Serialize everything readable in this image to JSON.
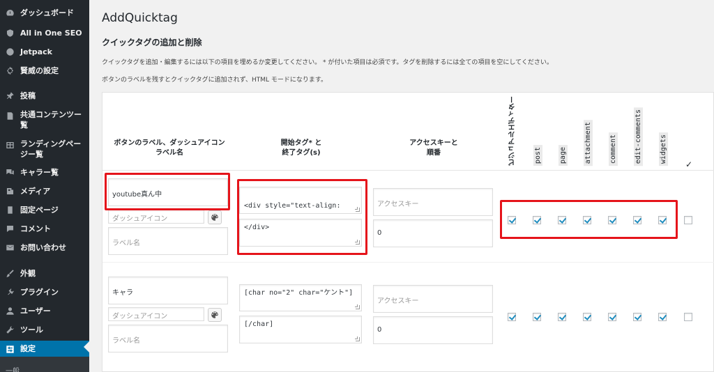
{
  "sidebar": {
    "items": [
      {
        "label": "ダッシュボード",
        "icon": "dashboard-icon"
      },
      {
        "label": "All in One SEO",
        "icon": "shield-icon"
      },
      {
        "label": "Jetpack",
        "icon": "jetpack-icon"
      },
      {
        "label": "賢威の設定",
        "icon": "gear-icon"
      },
      {
        "label": "投稿",
        "icon": "pin-icon"
      },
      {
        "label": "共通コンテンツー覧",
        "icon": "document-icon"
      },
      {
        "label": "ランディングページー覧",
        "icon": "table-icon"
      },
      {
        "label": "キャラー覧",
        "icon": "comments-icon"
      },
      {
        "label": "メディア",
        "icon": "media-icon"
      },
      {
        "label": "固定ページ",
        "icon": "page-icon"
      },
      {
        "label": "コメント",
        "icon": "comment-icon"
      },
      {
        "label": "お問い合わせ",
        "icon": "mail-icon"
      },
      {
        "label": "外観",
        "icon": "brush-icon"
      },
      {
        "label": "プラグイン",
        "icon": "plugin-icon"
      },
      {
        "label": "ユーザー",
        "icon": "user-icon"
      },
      {
        "label": "ツール",
        "icon": "wrench-icon"
      },
      {
        "label": "設定",
        "icon": "settings-icon"
      }
    ],
    "submenu_first": "一般"
  },
  "page": {
    "title": "AddQuicktag",
    "section_title": "クイックタグの追加と削除",
    "desc1": "クイックタグを追加・編集するには以下の項目を埋めるか変更してください。 * が付いた項目は必須です。タグを削除するには全ての項目を空にしてください。",
    "desc2": "ボタンのラベルを残すとクイックタグに追加されず、HTML モードになります。"
  },
  "table": {
    "headers": {
      "label": "ボタンのラベル、ダッシュアイコン\nラベル名",
      "tags": "開始タグ* と\n終了タグ(s)",
      "access": "アクセスキーと\n順番"
    },
    "columns": [
      "ビジュアルエディター",
      "post",
      "page",
      "attachment",
      "comment",
      "edit-comments",
      "widgets"
    ],
    "check_all": "✓",
    "rows": [
      {
        "button_label": "youtube真ん中",
        "dashicon_placeholder": "ダッシュアイコン",
        "label_name_placeholder": "ラベル名",
        "start_tag": "<div style=\"text-align:",
        "end_tag": "</div>",
        "access_key_placeholder": "アクセスキー",
        "order": "0",
        "checks": [
          true,
          true,
          true,
          true,
          true,
          true,
          true
        ],
        "select_all": false
      },
      {
        "button_label": "キャラ",
        "dashicon_placeholder": "ダッシュアイコン",
        "label_name_placeholder": "ラベル名",
        "start_tag": "[char no=\"2\" char=\"ケント\"]",
        "end_tag": "[/char]",
        "access_key_placeholder": "アクセスキー",
        "order": "0",
        "checks": [
          true,
          true,
          true,
          true,
          true,
          true,
          true
        ],
        "select_all": false
      }
    ]
  },
  "colors": {
    "sidebar_bg": "#23282d",
    "accent": "#0073aa",
    "highlight": "#e5141b"
  }
}
